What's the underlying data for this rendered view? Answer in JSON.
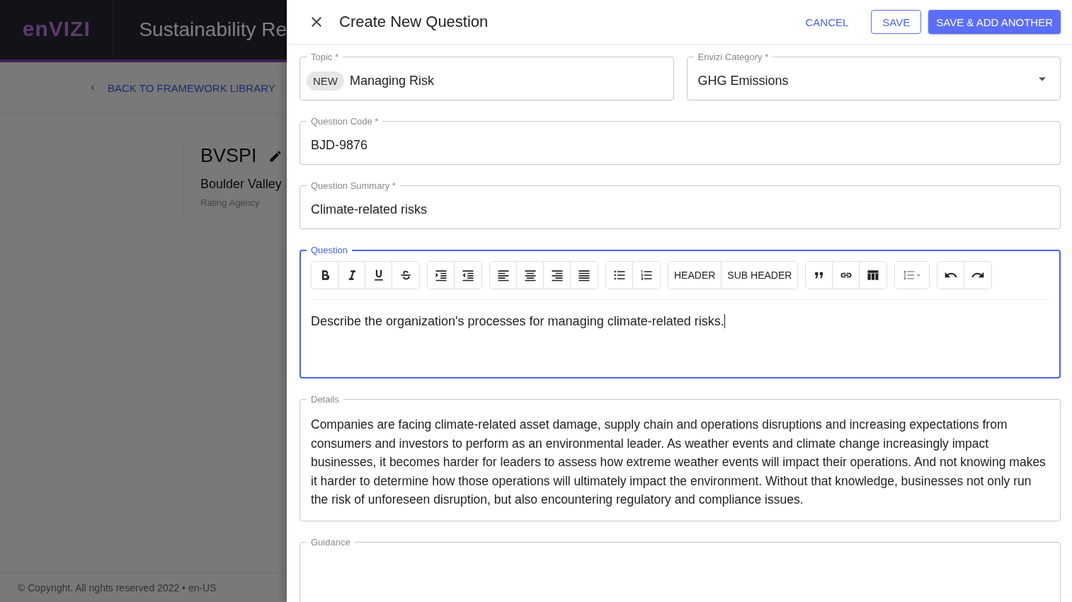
{
  "background_page": {
    "logo": "enVIZI",
    "app_title": "Sustainability Re",
    "back_link": "BACK TO FRAMEWORK LIBRARY",
    "record": {
      "title": "BVSPI",
      "subtitle": "Boulder Valley",
      "caption": "Rating Agency"
    },
    "footer": "© Copyright. All rights reserved 2022 • en-US"
  },
  "drawer": {
    "title": "Create New Question",
    "actions": [
      {
        "label": "CANCEL",
        "kind": "link"
      },
      {
        "label": "SAVE",
        "kind": "outlined"
      },
      {
        "label": "SAVE & ADD ANOTHER",
        "kind": "filled"
      }
    ],
    "topic": {
      "label": "Topic *",
      "chip": "NEW",
      "value": "Managing Risk"
    },
    "category": {
      "label": "Envizi Category *",
      "value": "GHG Emissions"
    },
    "question_code": {
      "label": "Question Code *",
      "value": "BJD-9876"
    },
    "question_summary": {
      "label": "Question Summary *",
      "value": "Climate-related risks"
    },
    "question": {
      "label": "Question",
      "focused": true,
      "toolbar": [
        {
          "tools": [
            {
              "kind": "bold"
            },
            {
              "kind": "italic"
            },
            {
              "kind": "underline"
            },
            {
              "kind": "strike"
            }
          ]
        },
        {
          "tools": [
            {
              "kind": "indent"
            },
            {
              "kind": "outdent"
            }
          ]
        },
        {
          "tools": [
            {
              "kind": "align-left"
            },
            {
              "kind": "align-center"
            },
            {
              "kind": "align-right"
            },
            {
              "kind": "justify"
            }
          ]
        },
        {
          "tools": [
            {
              "kind": "bullet-list"
            },
            {
              "kind": "numbered-list"
            }
          ]
        },
        {
          "tools": [
            {
              "kind": "text",
              "label": "HEADER"
            },
            {
              "kind": "text",
              "label": "SUB HEADER"
            }
          ]
        },
        {
          "tools": [
            {
              "kind": "quote"
            },
            {
              "kind": "link"
            },
            {
              "kind": "table"
            }
          ]
        },
        {
          "tools": [
            {
              "kind": "line-spacing"
            }
          ]
        },
        {
          "tools": [
            {
              "kind": "undo"
            },
            {
              "kind": "redo"
            }
          ]
        }
      ],
      "value": "Describe the organization's processes for managing climate-related risks."
    },
    "details": {
      "label": "Details",
      "value": "Companies are facing climate-related asset damage, supply chain and operations disruptions and increasing expectations from consumers and investors to perform as an environmental leader. As weather events and climate change increasingly impact businesses, it becomes harder for leaders to assess how extreme weather events will impact their operations. And not knowing makes it harder to determine how those operations will ultimately impact the environment. Without that knowledge, businesses not only run the risk of unforeseen disruption, but also encountering regulatory and compliance issues."
    },
    "guidance": {
      "label": "Guidance"
    }
  }
}
